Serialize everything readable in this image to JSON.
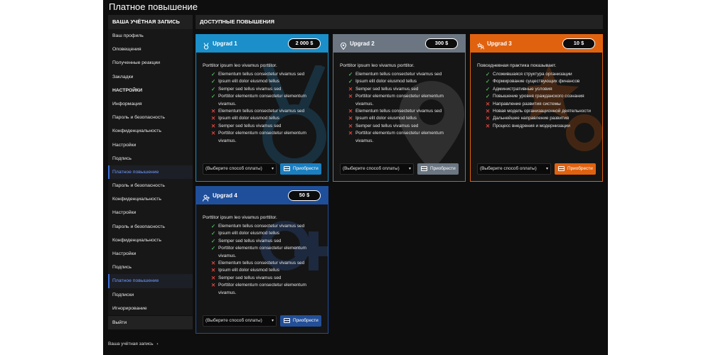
{
  "page_title": "Платное повышение",
  "sidebar": {
    "account_header": "ВАША УЧЁТНАЯ ЗАПИСЬ",
    "account_items": [
      {
        "label": "Ваш профиль"
      },
      {
        "label": "Оповещения"
      },
      {
        "label": "Полученные реакции"
      },
      {
        "label": "Закладки"
      }
    ],
    "settings_header": "НАСТРОЙКИ",
    "settings_items": [
      {
        "label": "Информация"
      },
      {
        "label": "Пароль и безопасность"
      },
      {
        "label": "Конфиденциальность"
      },
      {
        "label": "Настройки"
      },
      {
        "label": "Подпись"
      },
      {
        "label": "Платное повышение",
        "active": true
      }
    ],
    "extra_items_1": [
      {
        "label": "Пароль и безопасность"
      },
      {
        "label": "Конфиденциальность"
      },
      {
        "label": "Настройки"
      }
    ],
    "extra_items_2": [
      {
        "label": "Пароль и безопасность"
      },
      {
        "label": "Конфиденциальность"
      },
      {
        "label": "Настройки"
      },
      {
        "label": "Подпись"
      },
      {
        "label": "Платное повышение",
        "active": true
      },
      {
        "label": "Подписки"
      },
      {
        "label": "Игнорирование"
      }
    ],
    "logout": "Выйти",
    "footer": "Ваша учётная запись",
    "footer_chevron": "›"
  },
  "main": {
    "header": "ДОСТУПНЫЕ ПОВЫШЕНИЯ",
    "select_placeholder": "(Выберите способ оплаты)",
    "buy_label": "Приобрести",
    "cards": [
      {
        "name": "Upgrad 1",
        "price": "2 000 $",
        "icon": "medal-icon",
        "color": "#1a8fc9",
        "button_color": "#1b7fc0",
        "intro": "Porttitor ipsum leo vivamus porttitor.",
        "features": [
          {
            "text": "Elementum tellus consectetur vivamus sed",
            "ok": true
          },
          {
            "text": "Ipsum elit dolor eiusmod tellus",
            "ok": true
          },
          {
            "text": "Semper sed tellus vivamus sed",
            "ok": true
          },
          {
            "text": "Porttitor elementum consectetur elementum vivamus.",
            "ok": true
          },
          {
            "text": "Elementum tellus consectetur vivamus sed",
            "ok": false
          },
          {
            "text": "Ipsum elit dolor eiusmod tellus",
            "ok": false
          },
          {
            "text": "Semper sed tellus vivamus sed",
            "ok": false
          },
          {
            "text": "Porttitor elementum consectetur elementum vivamus.",
            "ok": false
          }
        ]
      },
      {
        "name": "Upgrad 2",
        "price": "300 $",
        "icon": "location-pin-icon",
        "color": "#6b7682",
        "button_color": "#6b7682",
        "intro": "Porttitor ipsum leo vivamus porttitor.",
        "features": [
          {
            "text": "Elementum tellus consectetur vivamus sed",
            "ok": true
          },
          {
            "text": "Ipsum elit dolor eiusmod tellus",
            "ok": true
          },
          {
            "text": "Semper sed tellus vivamus sed",
            "ok": false
          },
          {
            "text": "Porttitor elementum consectetur elementum vivamus.",
            "ok": false
          },
          {
            "text": "Elementum tellus consectetur vivamus sed",
            "ok": false
          },
          {
            "text": "Ipsum elit dolor eiusmod tellus",
            "ok": false
          },
          {
            "text": "Semper sed tellus vivamus sed",
            "ok": false
          },
          {
            "text": "Porttitor elementum consectetur elementum vivamus.",
            "ok": false
          }
        ]
      },
      {
        "name": "Upgrad 3",
        "price": "10 $",
        "icon": "star-user-icon",
        "color": "#e0620f",
        "button_color": "#e0620f",
        "intro": "Повседневная практика показывает.",
        "features": [
          {
            "text": "Сложившаяся структура организации",
            "ok": true
          },
          {
            "text": "Формирование существующих финансов",
            "ok": true
          },
          {
            "text": "Административные условия",
            "ok": true
          },
          {
            "text": "Повышение уровня гражданского сознания",
            "ok": true
          },
          {
            "text": "Направление развития системы",
            "ok": false
          },
          {
            "text": "Новая модель организационной деятельности",
            "ok": false
          },
          {
            "text": "Дальнейшее направление развития",
            "ok": false
          },
          {
            "text": "Процесс внедрения и модернизации",
            "ok": false
          }
        ]
      },
      {
        "name": "Upgrad 4",
        "price": "50 $",
        "icon": "user-plus-icon",
        "color": "#1f4f9a",
        "button_color": "#234f98",
        "intro": "Porttitor ipsum leo vivamus porttitor.",
        "features": [
          {
            "text": "Elementum tellus consectetur vivamus sed",
            "ok": true
          },
          {
            "text": "Ipsum elit dolor eiusmod tellus",
            "ok": true
          },
          {
            "text": "Semper sed tellus vivamus sed",
            "ok": true
          },
          {
            "text": "Porttitor elementum consectetur elementum vivamus.",
            "ok": true
          },
          {
            "text": "Elementum tellus consectetur vivamus sed",
            "ok": false
          },
          {
            "text": "Ipsum elit dolor eiusmod tellus",
            "ok": false
          },
          {
            "text": "Semper sed tellus vivamus sed",
            "ok": false
          },
          {
            "text": "Porttitor elementum consectetur elementum vivamus.",
            "ok": false
          }
        ]
      }
    ]
  },
  "icons": {
    "check": "✓",
    "cross": "✕",
    "dropdown": "▾"
  }
}
